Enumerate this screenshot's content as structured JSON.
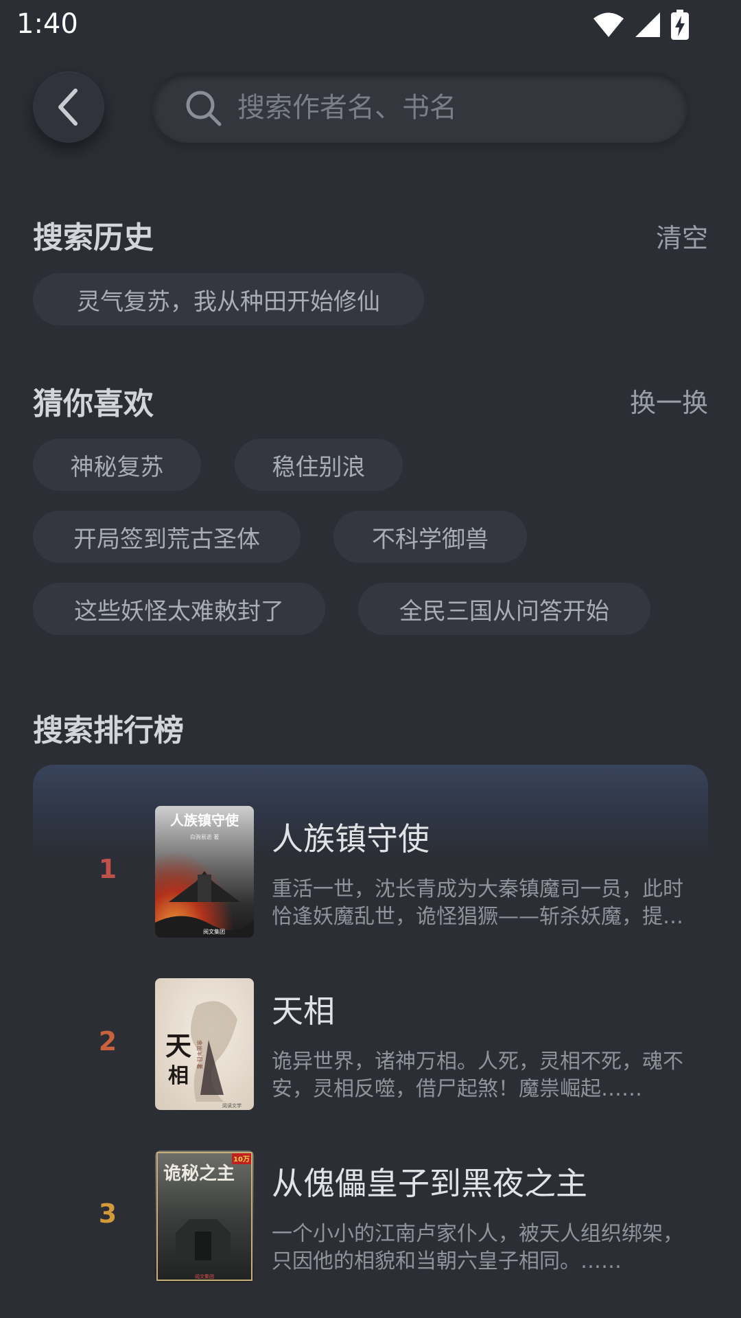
{
  "status_bar": {
    "time": "1:40"
  },
  "search": {
    "placeholder": "搜索作者名、书名"
  },
  "history": {
    "title": "搜索历史",
    "clear_label": "清空",
    "items": [
      "灵气复苏，我从种田开始修仙"
    ]
  },
  "recommend": {
    "title": "猜你喜欢",
    "refresh_label": "换一换",
    "items": [
      "神秘复苏",
      "稳住别浪",
      "开局签到荒古圣体",
      "不科学御兽",
      "这些妖怪太难敕封了",
      "全民三国从问答开始"
    ]
  },
  "ranking": {
    "title": "搜索排行榜",
    "items": [
      {
        "rank": "1",
        "rank_color": "#c0514a",
        "title": "人族镇守使",
        "desc": "重活一世，沈长青成为大秦镇魔司一员，此时恰逢妖魔乱世，诡怪猖獗——斩杀妖魔，提升自身实力……",
        "cover_text": "人族镇守使",
        "cover_author": "白驹易逝 著",
        "cover_publisher": "阅文集团"
      },
      {
        "rank": "2",
        "rank_color": "#c8623c",
        "title": "天相",
        "desc": "诡异世界，诸神万相。人死，灵相不死，魂不安，灵相反噬，借尸起煞！魔祟崛起……",
        "cover_text": "天相",
        "cover_author": "余出半日 著",
        "cover_publisher": "阅读文学"
      },
      {
        "rank": "3",
        "rank_color": "#d39a3a",
        "title": "从傀儡皇子到黑夜之主",
        "desc": "一个小小的江南卢家仆人，被天人组织绑架，只因他的相貌和当朝六皇子相同。……",
        "cover_text": "诡秘之主",
        "cover_badge": "10万",
        "cover_publisher": "阅文集团"
      }
    ]
  }
}
